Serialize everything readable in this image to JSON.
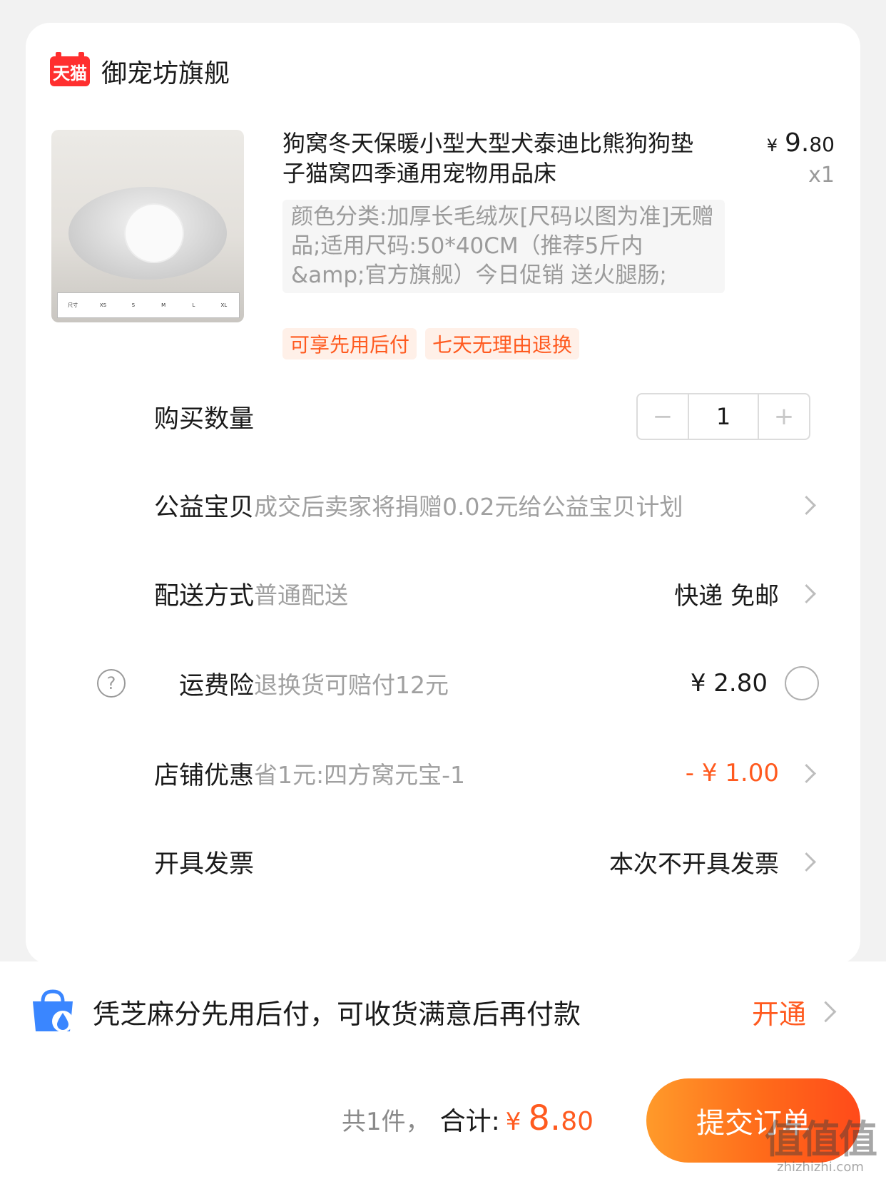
{
  "shop": {
    "badge": "天猫",
    "name": "御宠坊旗舰"
  },
  "product": {
    "image_alt": "pet-bed-photo",
    "size_table": [
      "尺寸",
      "XS",
      "S",
      "M",
      "L",
      "XL"
    ],
    "title": "狗窝冬天保暖小型大型犬泰迪比熊狗狗垫子猫窝四季通用宠物用品床",
    "price_yen": "¥",
    "price_int": "9.",
    "price_dec": "80",
    "quantity_label": "x1",
    "spec": "颜色分类:加厚长毛绒灰[尺码以图为准]无赠品;适用尺码:50*40CM（推荐5斤内&amp;官方旗舰）今日促销 送火腿肠;",
    "tags": [
      "可享先用后付",
      "七天无理由退换"
    ]
  },
  "rows": {
    "quantity": {
      "label": "购买数量",
      "minus": "−",
      "value": "1",
      "plus": "+"
    },
    "charity": {
      "label": "公益宝贝",
      "desc": "成交后卖家将捐赠0.02元给公益宝贝计划"
    },
    "delivery": {
      "label": "配送方式",
      "desc": "普通配送",
      "value": "快递 免邮"
    },
    "insurance": {
      "help": "?",
      "label": "运费险",
      "desc": "退换货可赔付12元",
      "value": "¥ 2.80"
    },
    "discount": {
      "label": "店铺优惠",
      "desc": "省1元:四方窝元宝-1",
      "value": "- ¥ 1.00"
    },
    "invoice": {
      "label": "开具发票",
      "value": "本次不开具发票"
    }
  },
  "pay_later": {
    "text": "凭芝麻分先用后付，可收货满意后再付款",
    "action": "开通"
  },
  "footer": {
    "count": "共1件，",
    "total_label": "合计:",
    "yen": "¥",
    "total_int": "8.",
    "total_dec": "80",
    "submit": "提交订单"
  },
  "watermark": {
    "main": "值值值",
    "sub": "zhizhizhi.com"
  },
  "colors": {
    "accent": "#ff5a1f",
    "tmall": "#ff2f2f",
    "background": "#f2f2f2"
  }
}
